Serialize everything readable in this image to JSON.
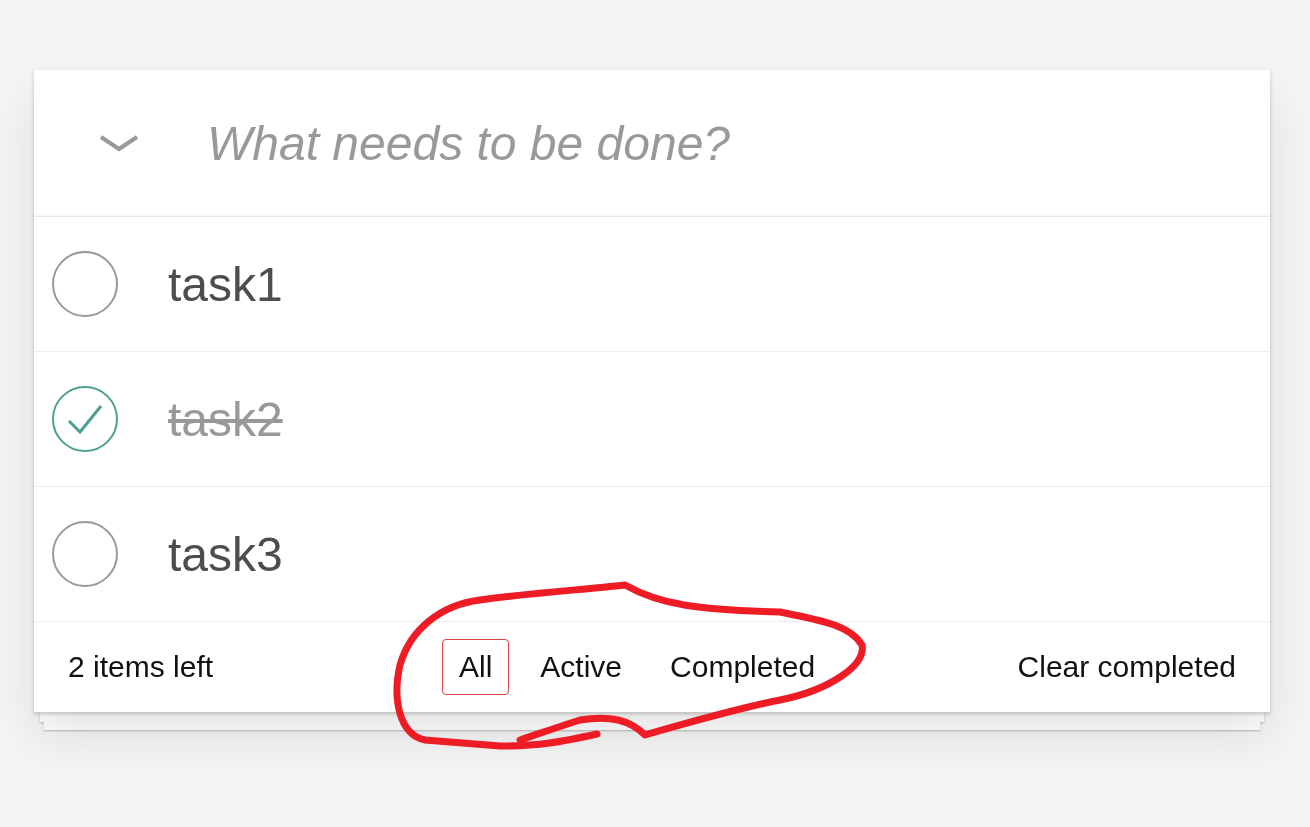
{
  "new_todo": {
    "placeholder": "What needs to be done?"
  },
  "todos": [
    {
      "text": "task1",
      "completed": false
    },
    {
      "text": "task2",
      "completed": true
    },
    {
      "text": "task3",
      "completed": false
    }
  ],
  "footer": {
    "count": "2 items left",
    "filters": [
      {
        "label": "All",
        "selected": true
      },
      {
        "label": "Active",
        "selected": false
      },
      {
        "label": "Completed",
        "selected": false
      }
    ],
    "clear": "Clear completed"
  }
}
